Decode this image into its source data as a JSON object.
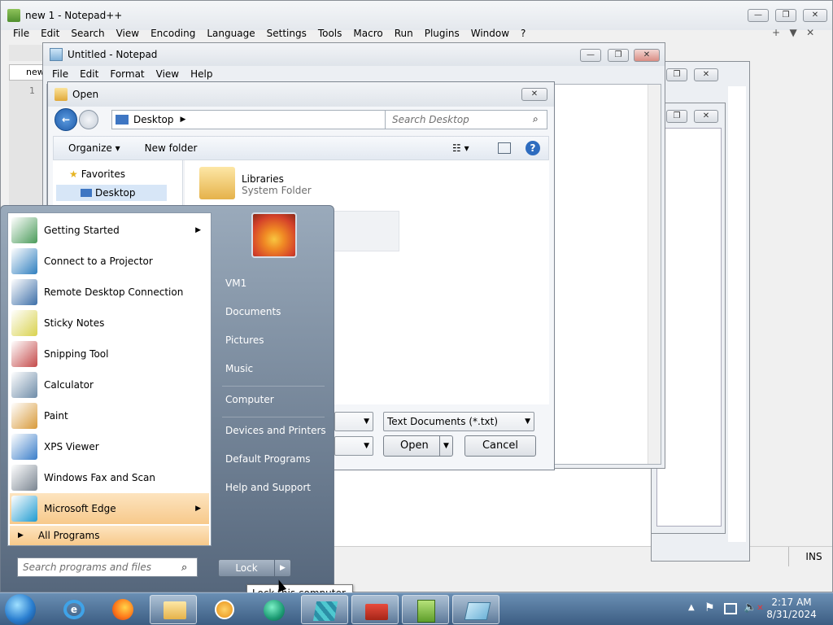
{
  "npp": {
    "title": "new 1 - Notepad++",
    "menu": [
      "File",
      "Edit",
      "Search",
      "View",
      "Encoding",
      "Language",
      "Settings",
      "Tools",
      "Macro",
      "Run",
      "Plugins",
      "Window",
      "?"
    ],
    "tab": "new",
    "line_number": "1",
    "status_ins": "INS"
  },
  "notepad": {
    "title": "Untitled - Notepad",
    "menu": [
      "File",
      "Edit",
      "Format",
      "View",
      "Help"
    ]
  },
  "open_dialog": {
    "title": "Open",
    "address": "Desktop",
    "search_placeholder": "Search Desktop",
    "organize": "Organize",
    "new_folder": "New folder",
    "nav": {
      "favorites": "Favorites",
      "desktop": "Desktop"
    },
    "file": {
      "name": "Libraries",
      "type": "System Folder"
    },
    "filetype": "Text Documents (*.txt)",
    "open_label": "Open",
    "cancel_label": "Cancel"
  },
  "start_menu": {
    "programs": [
      {
        "label": "Getting Started",
        "icon": "getting-started-icon",
        "color": "#4a9b5a",
        "submenu": true
      },
      {
        "label": "Connect to a Projector",
        "icon": "projector-icon",
        "color": "#2f7fbf",
        "submenu": false
      },
      {
        "label": "Remote Desktop Connection",
        "icon": "remote-desktop-icon",
        "color": "#3d6fa8",
        "submenu": false
      },
      {
        "label": "Sticky Notes",
        "icon": "sticky-notes-icon",
        "color": "#d9d24e",
        "submenu": false
      },
      {
        "label": "Snipping Tool",
        "icon": "snipping-tool-icon",
        "color": "#c44a4a",
        "submenu": false
      },
      {
        "label": "Calculator",
        "icon": "calculator-icon",
        "color": "#6e8ca8",
        "submenu": false
      },
      {
        "label": "Paint",
        "icon": "paint-icon",
        "color": "#d89a3a",
        "submenu": false
      },
      {
        "label": "XPS Viewer",
        "icon": "xps-viewer-icon",
        "color": "#3a7ec9",
        "submenu": false
      },
      {
        "label": "Windows Fax and Scan",
        "icon": "fax-scan-icon",
        "color": "#7a8591",
        "submenu": false
      },
      {
        "label": "Microsoft Edge",
        "icon": "edge-icon",
        "color": "#1f9bd1",
        "submenu": true
      }
    ],
    "all_programs": "All Programs",
    "search_placeholder": "Search programs and files",
    "right": [
      "VM1",
      "Documents",
      "Pictures",
      "Music",
      "Computer",
      "Devices and Printers",
      "Default Programs",
      "Help and Support"
    ],
    "lock_label": "Lock"
  },
  "tooltip": "Lock this computer.",
  "clock": {
    "time": "2:17 AM",
    "date": "8/31/2024"
  },
  "taskbar_icons": [
    "start-orb-icon",
    "ie-icon",
    "firefox-icon",
    "explorer-icon",
    "media-player-icon",
    "network-globe-icon",
    "cubes-icon",
    "toolbox-icon",
    "notepad-plus-icon",
    "tablet-icon"
  ]
}
